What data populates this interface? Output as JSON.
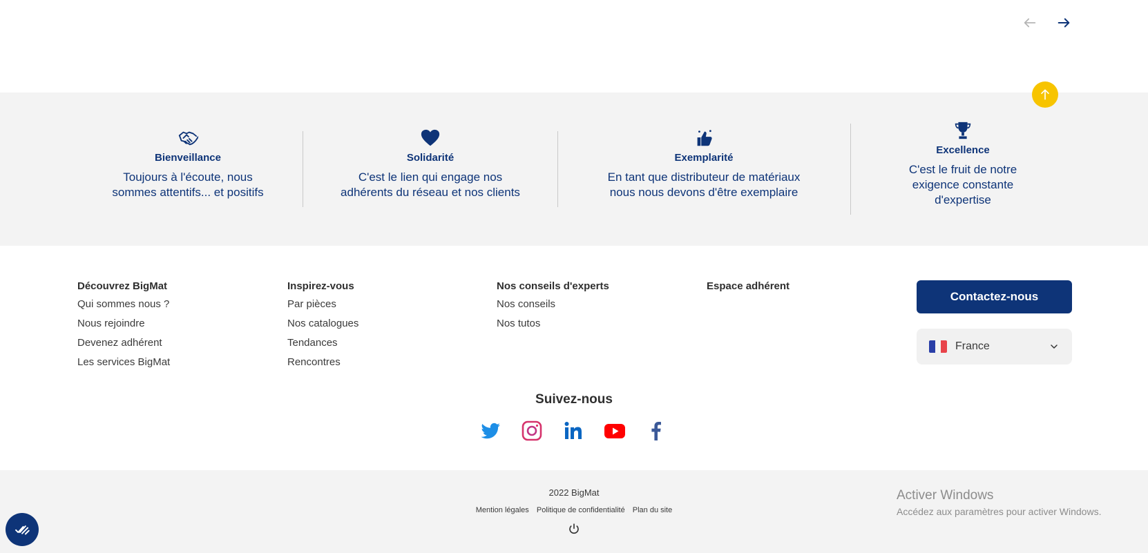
{
  "nav": {
    "prev_icon": "arrow-left-icon",
    "next_icon": "arrow-right-icon"
  },
  "scroll_top_icon": "arrow-up-icon",
  "values": [
    {
      "icon": "handshake-icon",
      "title": "Bienveillance",
      "line1": "Toujours à l'écoute, nous",
      "line2": "sommes attentifs... et positifs",
      "line3": ""
    },
    {
      "icon": "heart-icon",
      "title": "Solidarité",
      "line1": "C'est le lien qui engage nos",
      "line2": "adhérents du réseau et nos clients",
      "line3": ""
    },
    {
      "icon": "thumbs-up-icon",
      "title": "Exemplarité",
      "line1": "En tant que distributeur de matériaux",
      "line2": "nous nous devons d'être exemplaire",
      "line3": ""
    },
    {
      "icon": "trophy-icon",
      "title": "Excellence",
      "line1": "C'est le fruit de notre",
      "line2": "exigence constante",
      "line3": "d'expertise"
    }
  ],
  "footer": {
    "columns": [
      {
        "heading": "Découvrez BigMat",
        "links": [
          "Qui sommes nous ?",
          "Nous rejoindre",
          "Devenez adhérent",
          "Les services BigMat"
        ]
      },
      {
        "heading": "Inspirez-vous",
        "links": [
          "Par pièces",
          "Nos catalogues",
          "Tendances",
          "Rencontres"
        ]
      },
      {
        "heading": "Nos conseils d'experts",
        "links": [
          "Nos conseils",
          "Nos tutos"
        ]
      },
      {
        "heading": "Espace adhérent",
        "links": []
      }
    ],
    "contact_label": "Contactez-nous",
    "country": {
      "label": "France",
      "flag_icon": "france-flag-icon"
    },
    "follow_label": "Suivez-nous",
    "socials": [
      "twitter-icon",
      "instagram-icon",
      "linkedin-icon",
      "youtube-icon",
      "facebook-icon"
    ]
  },
  "bottom": {
    "copyright": "2022 BigMat",
    "links": [
      "Mention légales",
      "Politique de confidentialité",
      "Plan du site"
    ],
    "power_icon": "power-icon"
  },
  "windows_watermark": {
    "title": "Activer Windows",
    "subtitle": "Accédez aux paramètres pour activer Windows."
  },
  "colors": {
    "brand_blue": "#0e3478",
    "accent_yellow": "#f7c400",
    "band_gray": "#f3f3f3"
  }
}
